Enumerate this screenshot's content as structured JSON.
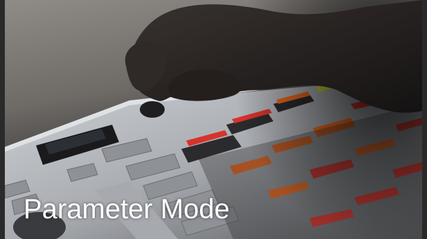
{
  "caption": "Parameter Mode",
  "scene": {
    "description_icon": "controller-photo",
    "colors": {
      "desk": "#8a8681",
      "device_body": "#b9bcc0",
      "pad_off": "#2b2b2d",
      "pad_orange": "#e8661f",
      "pad_red": "#d8322c",
      "pad_yellow": "#c9d63a"
    }
  }
}
